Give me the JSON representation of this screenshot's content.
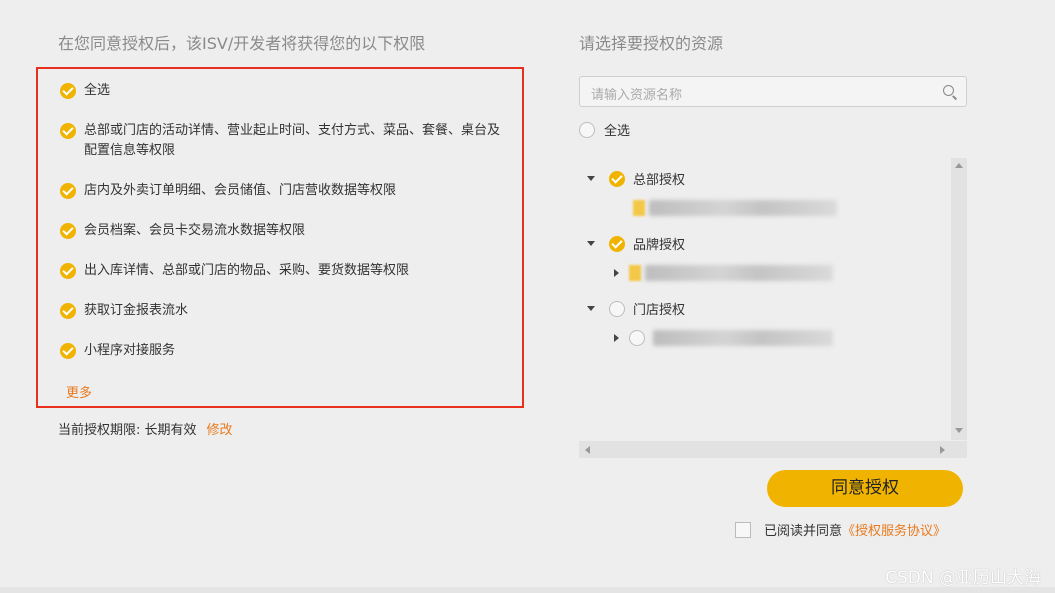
{
  "left": {
    "heading": "在您同意授权后，该ISV/开发者将获得您的以下权限",
    "permissions": [
      "全选",
      "总部或门店的活动详情、营业起止时间、支付方式、菜品、套餐、桌台及配置信息等权限",
      "店内及外卖订单明细、会员储值、门店营收数据等权限",
      "会员档案、会员卡交易流水数据等权限",
      "出入库详情、总部或门店的物品、采购、要货数据等权限",
      "获取订金报表流水",
      "小程序对接服务"
    ],
    "more_label": "更多",
    "expiry_label": "当前授权期限: 长期有效",
    "modify_label": "修改"
  },
  "right": {
    "heading": "请选择要授权的资源",
    "search_placeholder": "请输入资源名称",
    "select_all_label": "全选",
    "tree": [
      {
        "label": "总部授权",
        "checked": true
      },
      {
        "label": "品牌授权",
        "checked": true
      },
      {
        "label": "门店授权",
        "checked": false
      }
    ]
  },
  "footer": {
    "agree_button": "同意授权",
    "read_agree_text": "已阅读并同意",
    "protocol_link": "《授权服务协议》",
    "watermark": "CSDN @亚历山大海"
  },
  "colors": {
    "accent": "#f0b400",
    "link": "#e87a1e",
    "highlight_border": "#e8301f"
  }
}
